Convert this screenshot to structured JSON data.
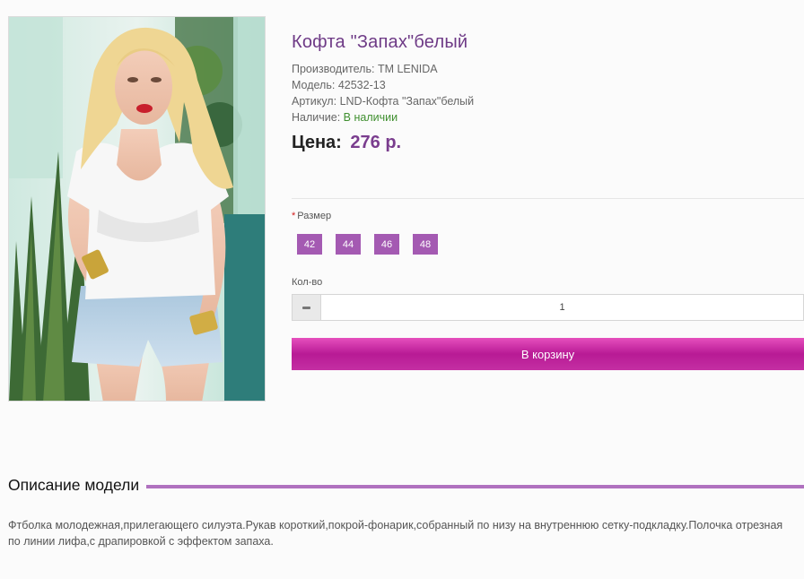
{
  "product": {
    "title": "Кофта \"Запах\"белый",
    "manufacturer_label": "Производитель:",
    "manufacturer_value": "TM LENIDA",
    "model_label": "Модель:",
    "model_value": "42532-13",
    "sku_label": "Артикул:",
    "sku_value": "LND-Кофта \"Запах\"белый",
    "availability_label": "Наличие:",
    "availability_value": "В наличии",
    "price_label": "Цена:",
    "price_value": "276 р."
  },
  "options": {
    "size_required_mark": "*",
    "size_label": "Размер",
    "sizes": [
      "42",
      "44",
      "46",
      "48"
    ],
    "qty_label": "Кол-во",
    "qty_value": "1",
    "add_to_cart_label": "В корзину"
  },
  "description": {
    "heading": "Описание модели",
    "text": "Фтболка молодежная,прилегающего силуэта.Рукав короткий,покрой-фонарик,собранный по низу на внутреннюю сетку-подкладку.Полочка отрезная по линии лифа,с драпировкой с эффектом запаха."
  },
  "colors": {
    "accent": "#a45ab2",
    "title": "#6e3a86",
    "button": "#c42fa3",
    "in_stock": "#3f8f2f"
  }
}
